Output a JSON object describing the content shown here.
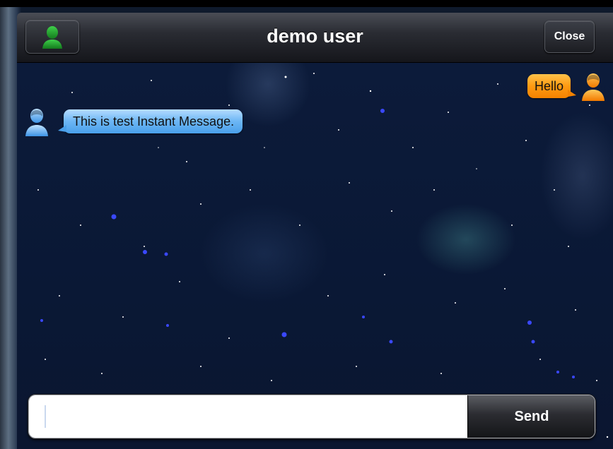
{
  "header": {
    "title": "demo user",
    "close_label": "Close",
    "avatar_icon": "user-silhouette-icon"
  },
  "messages": [
    {
      "direction": "outgoing",
      "text": "Hello",
      "bubble_color": "#ff9a12",
      "avatar_icon": "user-orange-icon"
    },
    {
      "direction": "incoming",
      "text": "This is test Instant Message.",
      "bubble_color": "#6cb6f5",
      "avatar_icon": "user-blue-icon"
    }
  ],
  "composer": {
    "value": "",
    "placeholder": "",
    "send_label": "Send"
  },
  "colors": {
    "background": "#0b1630",
    "outgoing_bubble": "#ff9a12",
    "incoming_bubble": "#6cb6f5",
    "header_avatar": "#1f9a2a"
  }
}
